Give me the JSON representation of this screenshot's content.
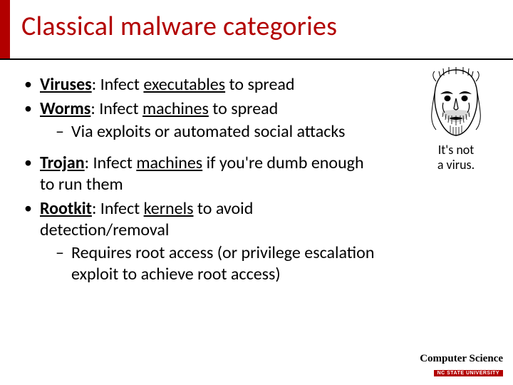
{
  "title": "Classical malware categories",
  "bullets": {
    "b1_term": "Viruses",
    "b1_rest1": ": Infect ",
    "b1_key": "executables",
    "b1_rest2": " to spread",
    "b2_term": "Worms",
    "b2_rest1": ": Infect ",
    "b2_key": "machines",
    "b2_rest2": " to spread",
    "b2_sub": "Via exploits or automated social attacks",
    "b3_term": "Trojan",
    "b3_rest1": ": Infect ",
    "b3_key": "machines",
    "b3_rest2": " if you're dumb enough to run them",
    "b4_term": "Rootkit",
    "b4_rest1": ": Infect ",
    "b4_key": "kernels",
    "b4_rest2": " to avoid detection/removal",
    "b4_sub": "Requires root access (or privilege escalation exploit to achieve root access)"
  },
  "portrait_caption_l1": "It's not",
  "portrait_caption_l2": "a virus.",
  "footer": {
    "line1": "Computer Science",
    "line2": "NC STATE UNIVERSITY"
  }
}
